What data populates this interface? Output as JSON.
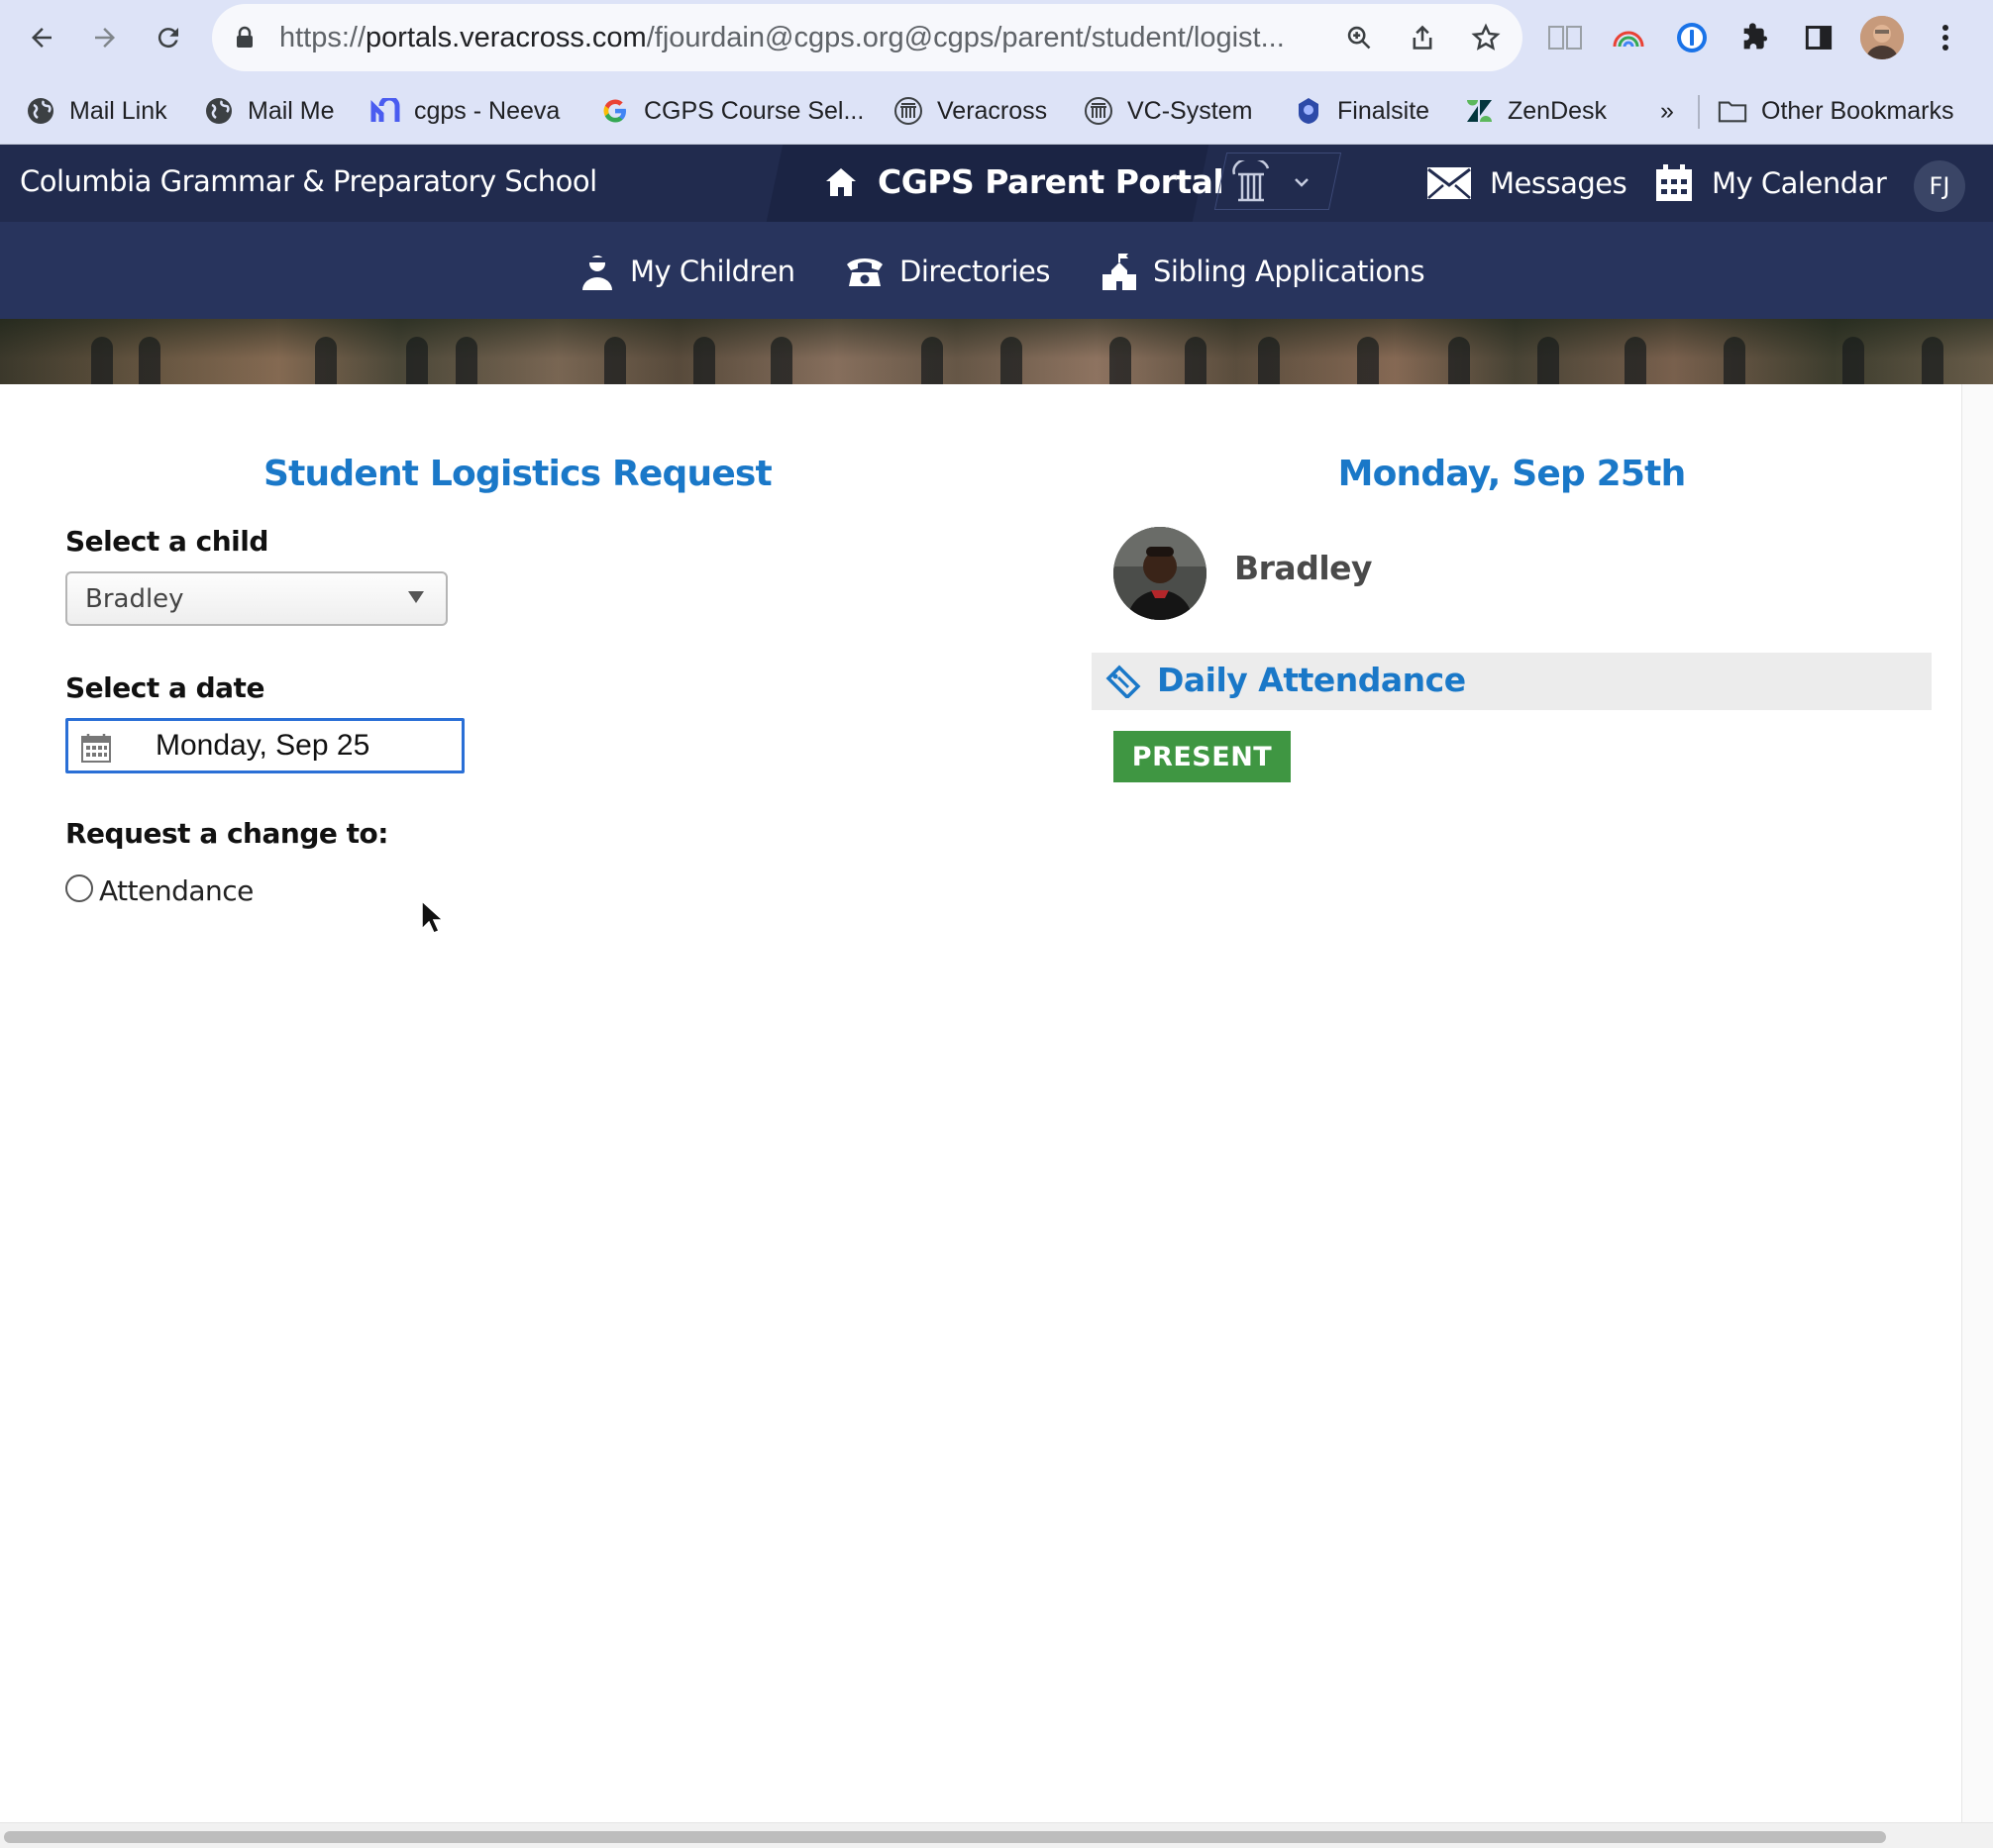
{
  "browser": {
    "url_prefix": "https://",
    "url_host": "portals.veracross.com",
    "url_path": "/fjourdain@cgps.org@cgps/parent/student/logist...",
    "bookmarks": [
      {
        "label": "Mail Link",
        "icon": "globe-icon"
      },
      {
        "label": "Mail Me",
        "icon": "globe-icon"
      },
      {
        "label": "cgps - Neeva",
        "icon": "neeva-icon"
      },
      {
        "label": "CGPS Course Sel...",
        "icon": "google-icon"
      },
      {
        "label": "Veracross",
        "icon": "veracross-icon"
      },
      {
        "label": "VC-System",
        "icon": "veracross-icon"
      },
      {
        "label": "Finalsite",
        "icon": "finalsite-icon"
      },
      {
        "label": "ZenDesk",
        "icon": "zendesk-icon"
      }
    ],
    "overflow_label": "»",
    "other_bookmarks": "Other Bookmarks"
  },
  "site": {
    "school_name": "Columbia Grammar & Preparatory School",
    "portal_title": "CGPS Parent Portal",
    "messages_label": "Messages",
    "calendar_label": "My Calendar",
    "user_initials": "FJ",
    "nav": {
      "my_children": "My Children",
      "directories": "Directories",
      "sibling_applications": "Sibling Applications"
    }
  },
  "form": {
    "heading": "Student Logistics Request",
    "child_label": "Select a child",
    "child_value": "Bradley",
    "date_label": "Select a date",
    "date_value": "Monday, Sep 25",
    "change_label": "Request a change to:",
    "option_attendance": "Attendance"
  },
  "summary": {
    "date_heading": "Monday, Sep 25th",
    "student_name": "Bradley",
    "section_title": "Daily Attendance",
    "status": "PRESENT"
  },
  "colors": {
    "header_dark": "#212b4e",
    "nav_bg": "#28345d",
    "accent_blue": "#1a78c8",
    "status_green": "#3f9642"
  }
}
